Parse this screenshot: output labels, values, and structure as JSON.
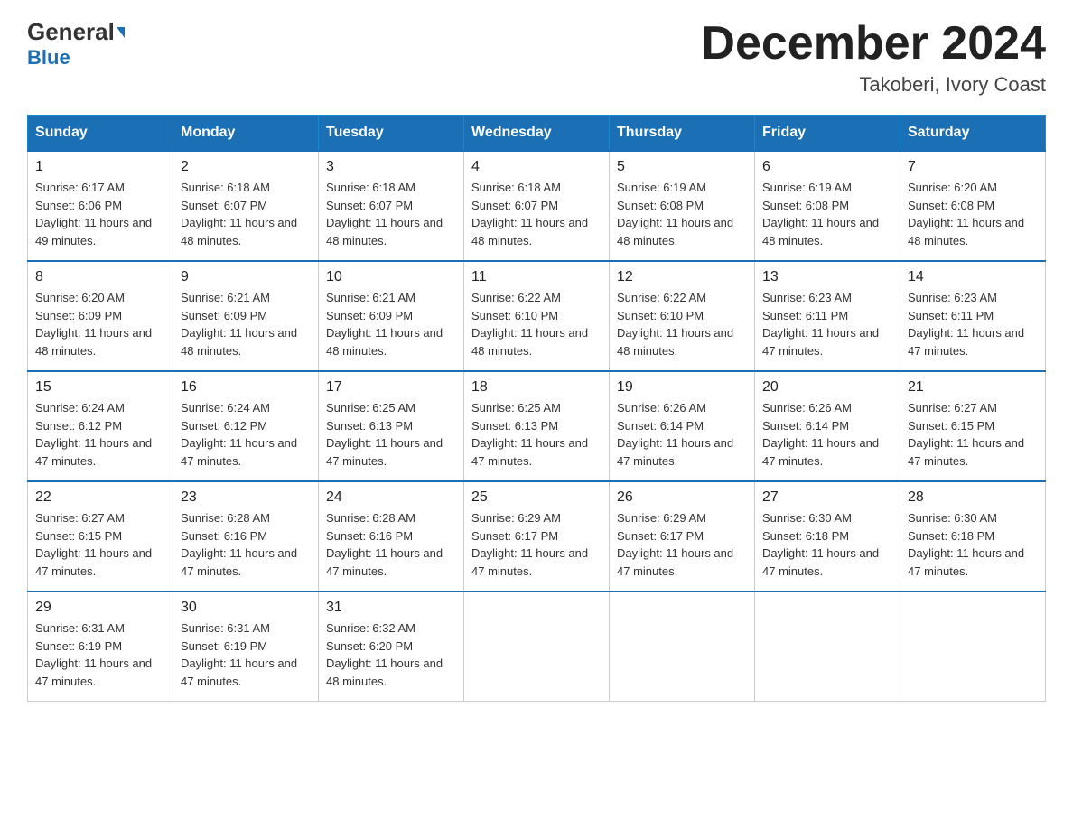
{
  "header": {
    "logo_general": "General",
    "logo_blue": "Blue",
    "month_title": "December 2024",
    "location": "Takoberi, Ivory Coast"
  },
  "weekdays": [
    "Sunday",
    "Monday",
    "Tuesday",
    "Wednesday",
    "Thursday",
    "Friday",
    "Saturday"
  ],
  "weeks": [
    [
      {
        "day": "1",
        "sunrise": "6:17 AM",
        "sunset": "6:06 PM",
        "daylight": "11 hours and 49 minutes."
      },
      {
        "day": "2",
        "sunrise": "6:18 AM",
        "sunset": "6:07 PM",
        "daylight": "11 hours and 48 minutes."
      },
      {
        "day": "3",
        "sunrise": "6:18 AM",
        "sunset": "6:07 PM",
        "daylight": "11 hours and 48 minutes."
      },
      {
        "day": "4",
        "sunrise": "6:18 AM",
        "sunset": "6:07 PM",
        "daylight": "11 hours and 48 minutes."
      },
      {
        "day": "5",
        "sunrise": "6:19 AM",
        "sunset": "6:08 PM",
        "daylight": "11 hours and 48 minutes."
      },
      {
        "day": "6",
        "sunrise": "6:19 AM",
        "sunset": "6:08 PM",
        "daylight": "11 hours and 48 minutes."
      },
      {
        "day": "7",
        "sunrise": "6:20 AM",
        "sunset": "6:08 PM",
        "daylight": "11 hours and 48 minutes."
      }
    ],
    [
      {
        "day": "8",
        "sunrise": "6:20 AM",
        "sunset": "6:09 PM",
        "daylight": "11 hours and 48 minutes."
      },
      {
        "day": "9",
        "sunrise": "6:21 AM",
        "sunset": "6:09 PM",
        "daylight": "11 hours and 48 minutes."
      },
      {
        "day": "10",
        "sunrise": "6:21 AM",
        "sunset": "6:09 PM",
        "daylight": "11 hours and 48 minutes."
      },
      {
        "day": "11",
        "sunrise": "6:22 AM",
        "sunset": "6:10 PM",
        "daylight": "11 hours and 48 minutes."
      },
      {
        "day": "12",
        "sunrise": "6:22 AM",
        "sunset": "6:10 PM",
        "daylight": "11 hours and 48 minutes."
      },
      {
        "day": "13",
        "sunrise": "6:23 AM",
        "sunset": "6:11 PM",
        "daylight": "11 hours and 47 minutes."
      },
      {
        "day": "14",
        "sunrise": "6:23 AM",
        "sunset": "6:11 PM",
        "daylight": "11 hours and 47 minutes."
      }
    ],
    [
      {
        "day": "15",
        "sunrise": "6:24 AM",
        "sunset": "6:12 PM",
        "daylight": "11 hours and 47 minutes."
      },
      {
        "day": "16",
        "sunrise": "6:24 AM",
        "sunset": "6:12 PM",
        "daylight": "11 hours and 47 minutes."
      },
      {
        "day": "17",
        "sunrise": "6:25 AM",
        "sunset": "6:13 PM",
        "daylight": "11 hours and 47 minutes."
      },
      {
        "day": "18",
        "sunrise": "6:25 AM",
        "sunset": "6:13 PM",
        "daylight": "11 hours and 47 minutes."
      },
      {
        "day": "19",
        "sunrise": "6:26 AM",
        "sunset": "6:14 PM",
        "daylight": "11 hours and 47 minutes."
      },
      {
        "day": "20",
        "sunrise": "6:26 AM",
        "sunset": "6:14 PM",
        "daylight": "11 hours and 47 minutes."
      },
      {
        "day": "21",
        "sunrise": "6:27 AM",
        "sunset": "6:15 PM",
        "daylight": "11 hours and 47 minutes."
      }
    ],
    [
      {
        "day": "22",
        "sunrise": "6:27 AM",
        "sunset": "6:15 PM",
        "daylight": "11 hours and 47 minutes."
      },
      {
        "day": "23",
        "sunrise": "6:28 AM",
        "sunset": "6:16 PM",
        "daylight": "11 hours and 47 minutes."
      },
      {
        "day": "24",
        "sunrise": "6:28 AM",
        "sunset": "6:16 PM",
        "daylight": "11 hours and 47 minutes."
      },
      {
        "day": "25",
        "sunrise": "6:29 AM",
        "sunset": "6:17 PM",
        "daylight": "11 hours and 47 minutes."
      },
      {
        "day": "26",
        "sunrise": "6:29 AM",
        "sunset": "6:17 PM",
        "daylight": "11 hours and 47 minutes."
      },
      {
        "day": "27",
        "sunrise": "6:30 AM",
        "sunset": "6:18 PM",
        "daylight": "11 hours and 47 minutes."
      },
      {
        "day": "28",
        "sunrise": "6:30 AM",
        "sunset": "6:18 PM",
        "daylight": "11 hours and 47 minutes."
      }
    ],
    [
      {
        "day": "29",
        "sunrise": "6:31 AM",
        "sunset": "6:19 PM",
        "daylight": "11 hours and 47 minutes."
      },
      {
        "day": "30",
        "sunrise": "6:31 AM",
        "sunset": "6:19 PM",
        "daylight": "11 hours and 47 minutes."
      },
      {
        "day": "31",
        "sunrise": "6:32 AM",
        "sunset": "6:20 PM",
        "daylight": "11 hours and 48 minutes."
      },
      null,
      null,
      null,
      null
    ]
  ]
}
